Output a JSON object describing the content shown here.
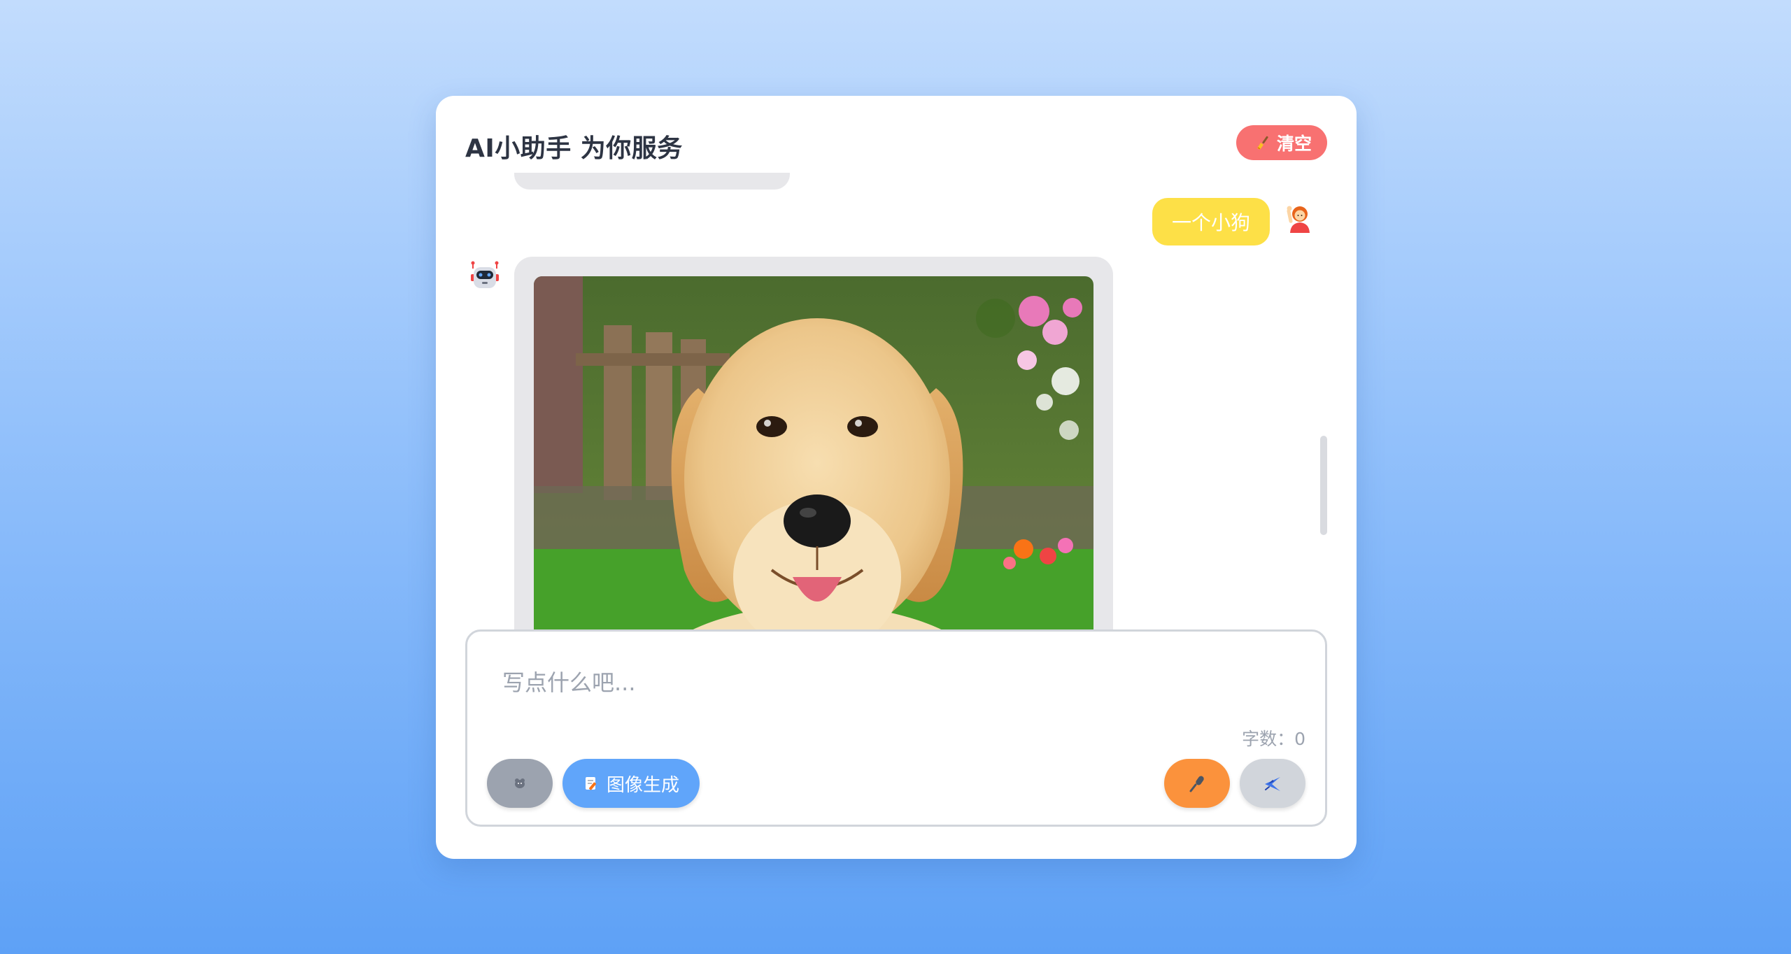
{
  "header": {
    "title": "AI小助手 为你服务",
    "clear_label": "清空",
    "clear_icon": "broom-icon"
  },
  "messages": [
    {
      "role": "user",
      "text": "一个小狗",
      "avatar": "person-raising-hand-icon"
    },
    {
      "role": "assistant",
      "avatar": "robot-icon",
      "content": "generated-image-golden-retriever-puppy"
    }
  ],
  "composer": {
    "placeholder": "写点什么吧...",
    "char_count_label": "字数：0"
  },
  "toolbar": {
    "left_icon_button": "mouse-icon",
    "image_gen_label": "图像生成",
    "image_gen_icon": "memo-icon",
    "mic_icon": "microphone-icon",
    "send_icon": "airplane-icon"
  },
  "colors": {
    "clear_button": "#f87171",
    "user_bubble": "#fde047",
    "image_gen_button": "#60a5fa",
    "mic_button": "#fb923c",
    "send_button": "#d1d5db"
  }
}
